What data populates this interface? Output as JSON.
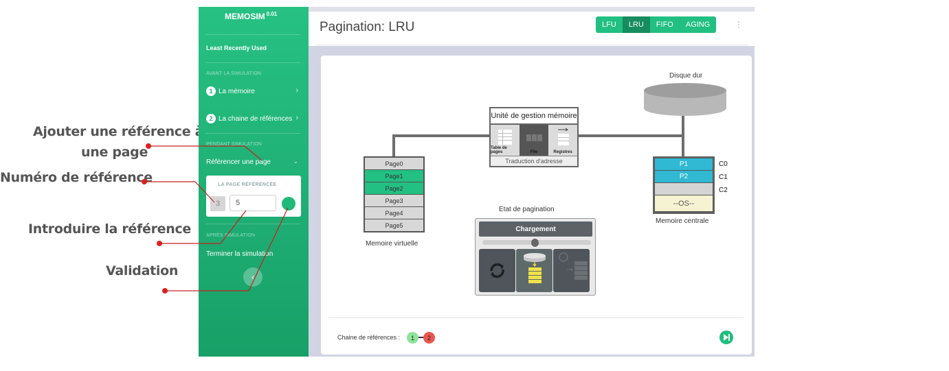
{
  "annotations": {
    "add_ref_line1": "Ajouter une référence à",
    "add_ref_line2": "une page",
    "ref_number": "Numéro de référence",
    "intro_ref": "Introduire la référence",
    "validation": "Validation"
  },
  "sidebar": {
    "brand": "MEMOSIM",
    "version": "0.01",
    "algo_name": "Least Recently Used",
    "section_before": "AVANT LA SIMULATION",
    "items_before": [
      {
        "num": "1",
        "label": "La mémoire"
      },
      {
        "num": "2",
        "label": "La chaine de références"
      }
    ],
    "section_during": "PENDANT SIMULATION",
    "ref_page_item": "Référencer une page",
    "ref_card": {
      "title": "LA PAGE RÉFÉRENCÉE",
      "ref_number": "3",
      "input_value": "5"
    },
    "section_after": "APRÈS SIMULATION",
    "end_item": "Terminer la simulation"
  },
  "header": {
    "title": "Pagination: LRU",
    "algorithms": [
      {
        "label": "LFU",
        "active": false
      },
      {
        "label": "LRU",
        "active": true
      },
      {
        "label": "FIFO",
        "active": false
      },
      {
        "label": "AGING",
        "active": false
      }
    ]
  },
  "diagram": {
    "disk_label": "Disque dur",
    "mmu": {
      "title": "Unité de gestion mémoire",
      "cells": [
        "Table de pages",
        "File",
        "Registres"
      ],
      "footer": "Traduction d'adresse"
    },
    "virtual_memory": {
      "label": "Memoire virtuelle",
      "pages": [
        {
          "label": "Page0",
          "loaded": false
        },
        {
          "label": "Page1",
          "loaded": true
        },
        {
          "label": "Page2",
          "loaded": true
        },
        {
          "label": "Page3",
          "loaded": false
        },
        {
          "label": "Page4",
          "loaded": false
        },
        {
          "label": "Page5",
          "loaded": false
        }
      ]
    },
    "central_memory": {
      "label": "Memoire centrale",
      "frames": [
        {
          "name": "C0",
          "content": "P1"
        },
        {
          "name": "C1",
          "content": "P2"
        },
        {
          "name": "C2",
          "content": ""
        }
      ],
      "os_label": "--OS--"
    },
    "pagination_state": {
      "label": "Etat de pagination",
      "head": "Chargement",
      "progress": 0.5
    }
  },
  "footer": {
    "chain_label": "Chaine de références :",
    "chain": [
      {
        "value": "1",
        "color": "#8fe39a"
      },
      {
        "value": "2",
        "color": "#e8574f"
      }
    ]
  }
}
